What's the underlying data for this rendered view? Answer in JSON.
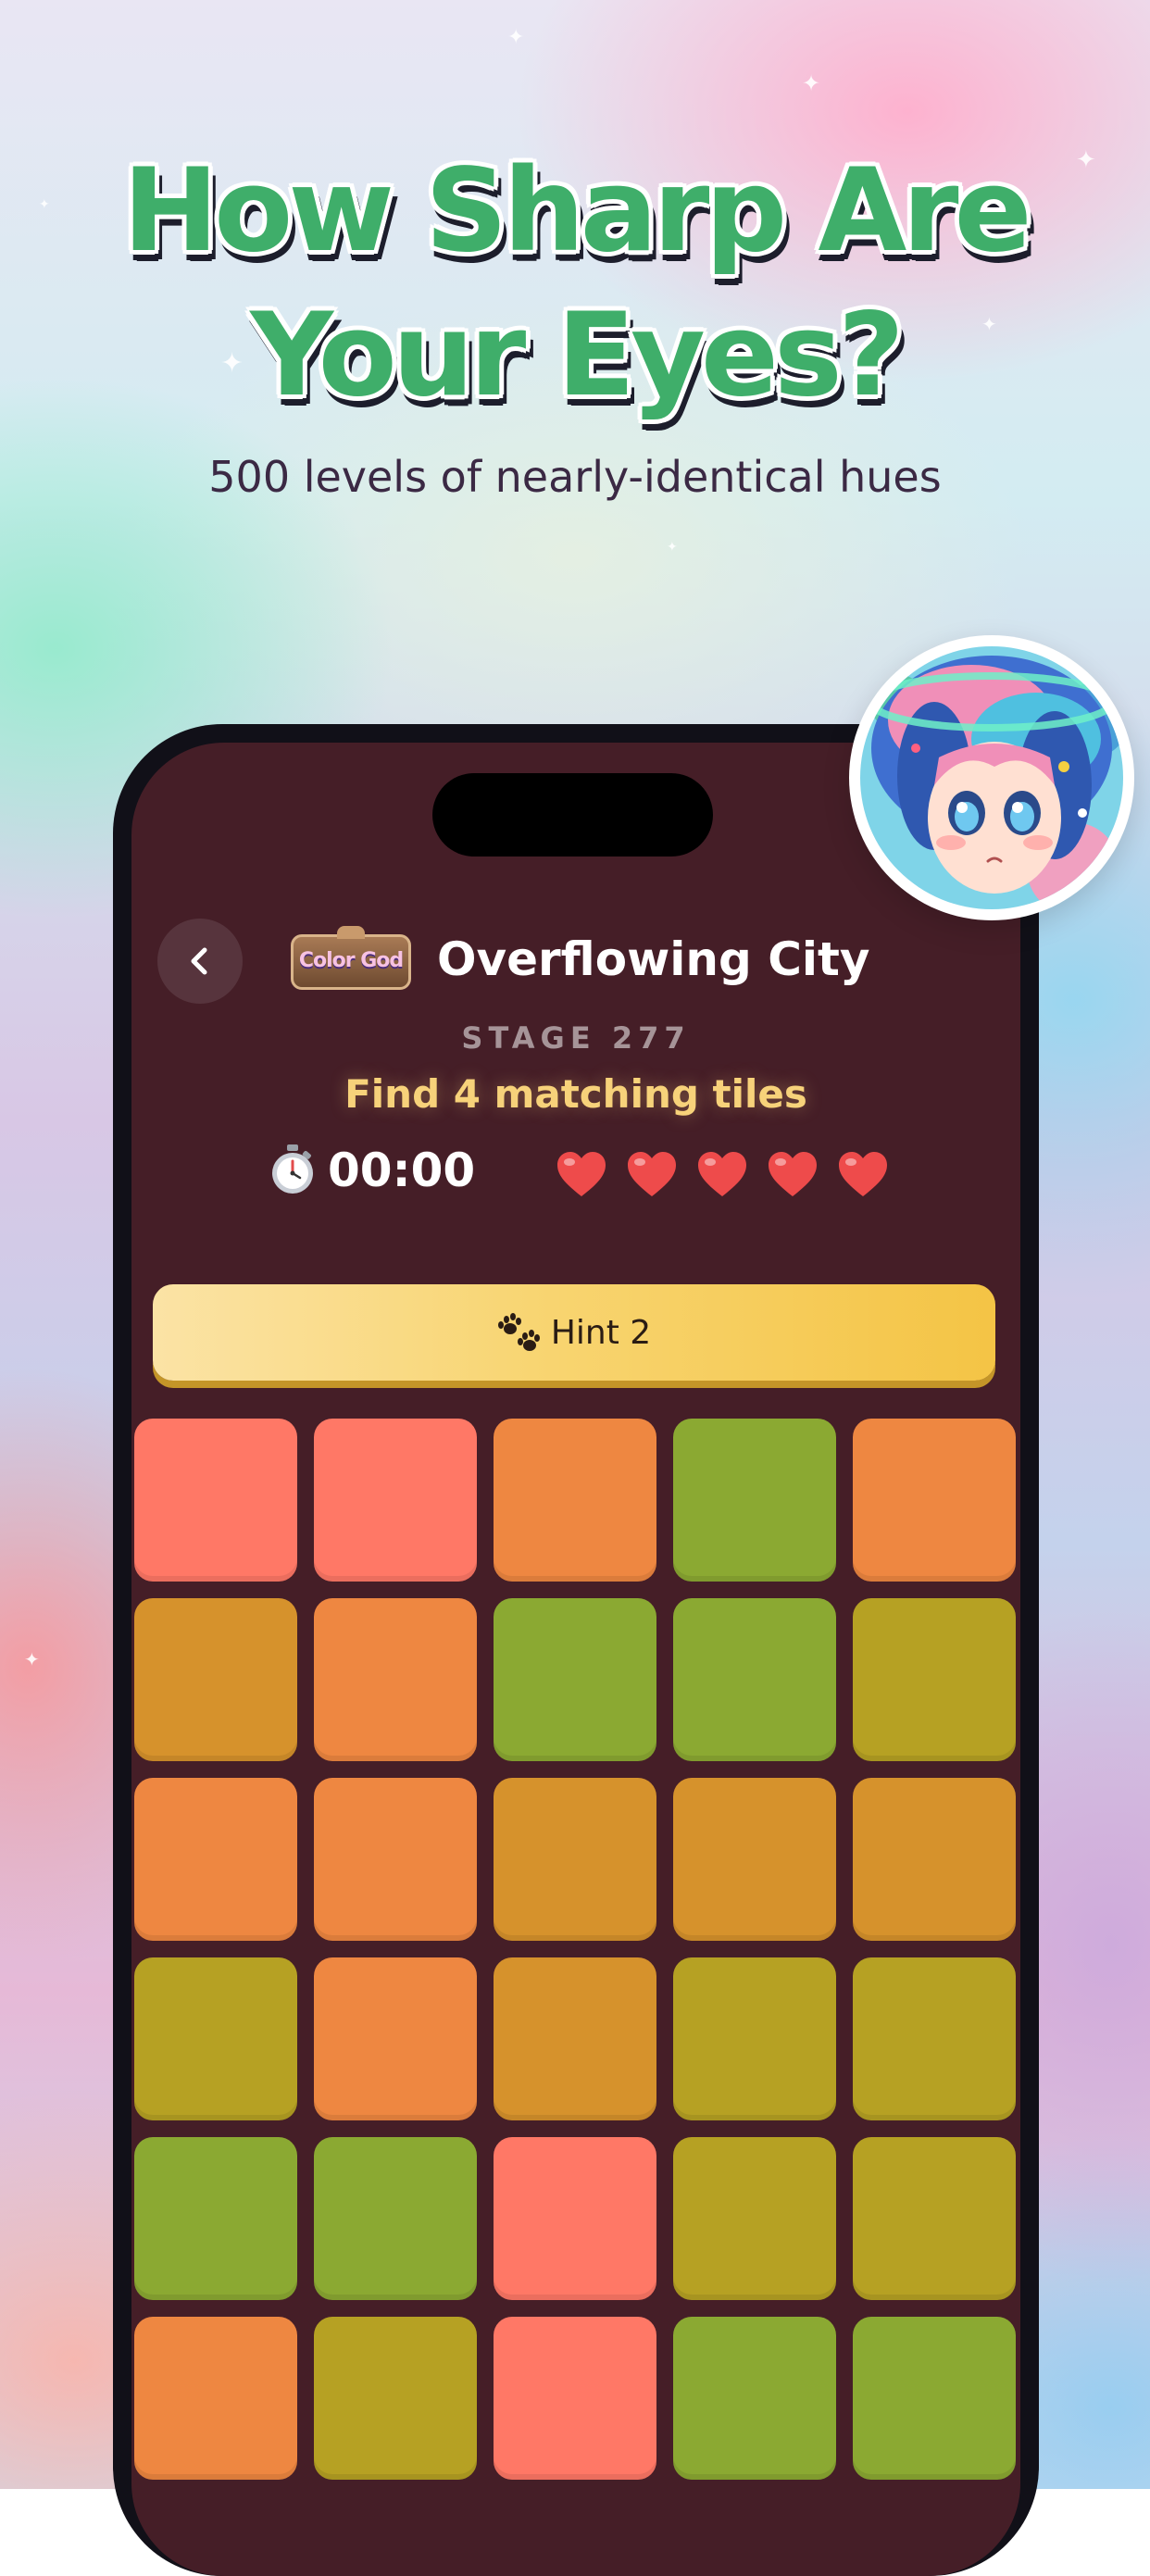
{
  "promo": {
    "headline_line1": "How Sharp Are",
    "headline_line2": "Your Eyes?",
    "subtitle": "500 levels of nearly-identical hues"
  },
  "game": {
    "logo_text": "Color God",
    "level_name": "Overflowing City",
    "stage": "STAGE 277",
    "instruction": "Find 4 matching tiles",
    "timer": "00:00",
    "lives": 5,
    "hint_label": "Hint 2"
  },
  "icons": {
    "back": "chevron-left-icon",
    "timer": "stopwatch-icon",
    "life": "heart-icon",
    "hint": "paw-prints-icon"
  },
  "colors": {
    "screen_bg": "#451e27",
    "headline": "#3fae6a",
    "instruction": "#f7d27a",
    "heart": "#ee4b4b",
    "hint_button": "#f4c445"
  },
  "tiles": [
    [
      "#ff7866",
      "#ff7866",
      "#ee8741",
      "#8ba932",
      "#ee8741"
    ],
    [
      "#d6922c",
      "#ee8741",
      "#8ba932",
      "#8ba932",
      "#b6a123"
    ],
    [
      "#ee8741",
      "#ee8741",
      "#d6922c",
      "#d6922c",
      "#d6922c"
    ],
    [
      "#b6a123",
      "#ee8741",
      "#d6922c",
      "#b6a123",
      "#b6a123"
    ],
    [
      "#8ba932",
      "#8ba932",
      "#ff7866",
      "#b6a123",
      "#b6a123"
    ],
    [
      "#ee8741",
      "#b6a123",
      "#ff7866",
      "#8ba932",
      "#8ba932"
    ]
  ]
}
